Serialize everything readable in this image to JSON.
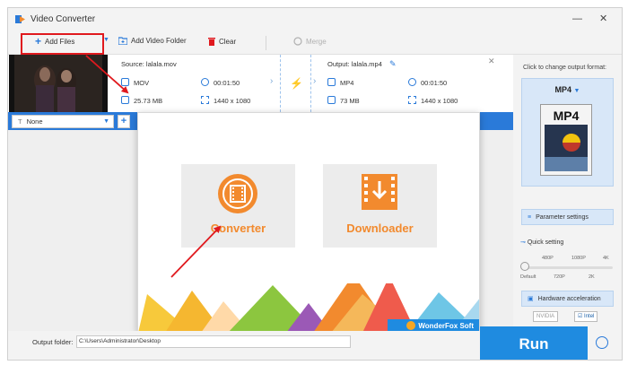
{
  "app": {
    "title": "Video Converter",
    "accent": "#2a7ad9",
    "annotation_color": "#e0191e"
  },
  "window_controls": {
    "minimize": "—",
    "close": "✕"
  },
  "toolbar": {
    "add_files": "Add Files",
    "add_video_folder": "Add Video Folder",
    "clear": "Clear",
    "merge": "Merge"
  },
  "file": {
    "source_label": "Source: lalala.mov",
    "output_label": "Output: lalala.mp4",
    "source": {
      "format": "MOV",
      "duration": "00:01:50",
      "size": "25.73 MB",
      "resolution": "1440 x 1080"
    },
    "output": {
      "format": "MP4",
      "duration": "00:01:50",
      "size": "73 MB",
      "resolution": "1440 x 1080"
    },
    "close": "✕"
  },
  "subtitle": {
    "selected": "None"
  },
  "popup": {
    "converter_label": "Converter",
    "downloader_label": "Downloader",
    "brand": "WonderFox Soft"
  },
  "right_panel": {
    "hint": "Click to change output format:",
    "format": "MP4",
    "format_icon_text": "MP4",
    "parameter_settings": "Parameter settings",
    "quick_setting": "Quick setting",
    "ticks_top": [
      "480P",
      "1080P",
      "4K"
    ],
    "ticks_bottom": [
      "Default",
      "720P",
      "2K"
    ],
    "hardware_acceleration": "Hardware acceleration",
    "nvidia": "NVIDIA",
    "intel": "Intel"
  },
  "bottom": {
    "output_folder_label": "Output folder:",
    "output_folder_value": "C:\\Users\\Administrator\\Desktop",
    "run_label": "Run"
  }
}
